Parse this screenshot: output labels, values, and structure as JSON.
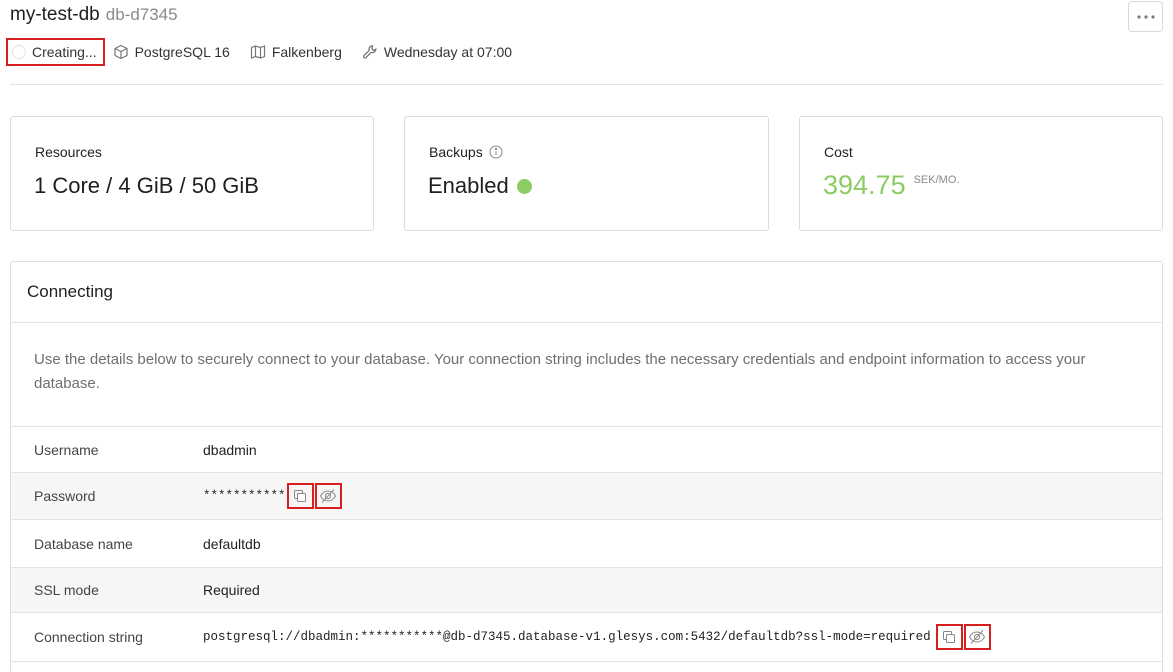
{
  "header": {
    "title": "my-test-db",
    "subtitle": "db-d7345",
    "more_icon": "ellipsis-icon"
  },
  "meta": {
    "status": "Creating...",
    "engine": "PostgreSQL 16",
    "location": "Falkenberg",
    "maintenance": "Wednesday at 07:00"
  },
  "cards": {
    "resources": {
      "label": "Resources",
      "value": "1 Core / 4 GiB / 50 GiB"
    },
    "backups": {
      "label": "Backups",
      "value": "Enabled",
      "status_color": "#8dcc64"
    },
    "cost": {
      "label": "Cost",
      "value": "394.75",
      "unit": "SEK/MO.",
      "value_color": "#8dcc64"
    }
  },
  "connecting": {
    "title": "Connecting",
    "description": "Use the details below to securely connect to your database. Your connection string includes the necessary credentials and endpoint information to access your database.",
    "rows": [
      {
        "label": "Username",
        "value": "dbadmin"
      },
      {
        "label": "Password",
        "value": "***********"
      },
      {
        "label": "Database name",
        "value": "defaultdb"
      },
      {
        "label": "SSL mode",
        "value": "Required"
      },
      {
        "label": "Connection string",
        "value": "postgresql://dbadmin:***********@db-d7345.database-v1.glesys.com:5432/defaultdb?ssl-mode=required"
      }
    ]
  },
  "colors": {
    "accent_green": "#8dcc64",
    "highlight_red": "#d62020"
  }
}
